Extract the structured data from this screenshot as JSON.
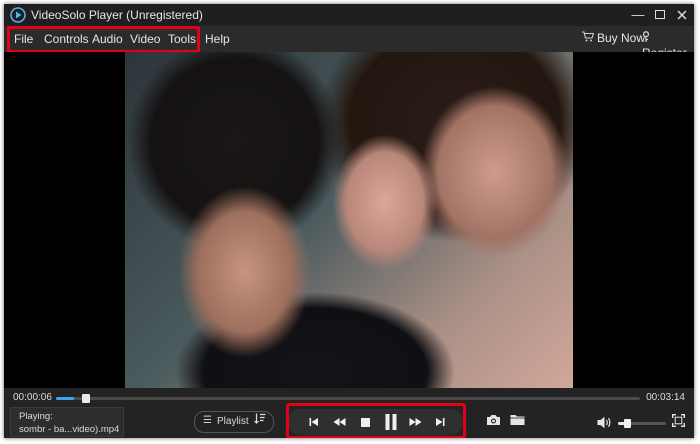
{
  "window": {
    "title": "VideoSolo Player (Unregistered)",
    "controls": {
      "minimize": "—"
    }
  },
  "menu": {
    "items": [
      {
        "label": "File"
      },
      {
        "label": "Controls"
      },
      {
        "label": "Audio"
      },
      {
        "label": "Video"
      },
      {
        "label": "Tools"
      },
      {
        "label": "Help"
      }
    ],
    "buy_now": "Buy Now",
    "register": "Register"
  },
  "player": {
    "current_time": "00:00:06",
    "total_time": "00:03:14",
    "progress_fraction": 0.031,
    "now_playing_label": "Playing:",
    "now_playing_file": "sombr - ba...video).mp4",
    "playlist_label": "Playlist",
    "state": "playing",
    "volume_fraction": 0.2
  },
  "icons": {
    "app": "play-logo-icon",
    "transport": [
      "skip-previous-icon",
      "rewind-icon",
      "stop-icon",
      "pause-icon",
      "fast-forward-icon",
      "skip-next-icon"
    ],
    "right": [
      "camera-icon",
      "folder-icon",
      "volume-icon",
      "fullscreen-icon"
    ]
  },
  "colors": {
    "accent": "#3ba6ea",
    "highlight": "#e3001b",
    "background": "#232323"
  }
}
